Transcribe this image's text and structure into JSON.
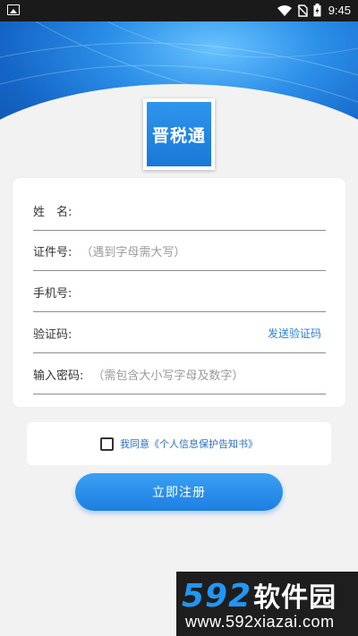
{
  "status_bar": {
    "time": "9:45",
    "icons": [
      "image-icon",
      "wifi-icon",
      "no-sim-icon",
      "battery-charging-icon"
    ]
  },
  "logo": {
    "text": "晋税通"
  },
  "form": {
    "name_label": "姓　名:",
    "id_label": "证件号:",
    "id_hint": "（遇到字母需大写）",
    "phone_label": "手机号:",
    "code_label": "验证码:",
    "send_code": "发送验证码",
    "password_label": "输入密码:",
    "password_hint": "（需包含大小写字母及数字）"
  },
  "agreement": {
    "text": "我同意《个人信息保护告知书》",
    "checked": false
  },
  "register_button": "立即注册",
  "watermark": {
    "brand_num": "592",
    "brand_cn": "软件园",
    "url": "www.592xiazai.com"
  },
  "colors": {
    "accent": "#1d7fe0",
    "link": "#2b82d9",
    "background": "#f2f2f2"
  }
}
